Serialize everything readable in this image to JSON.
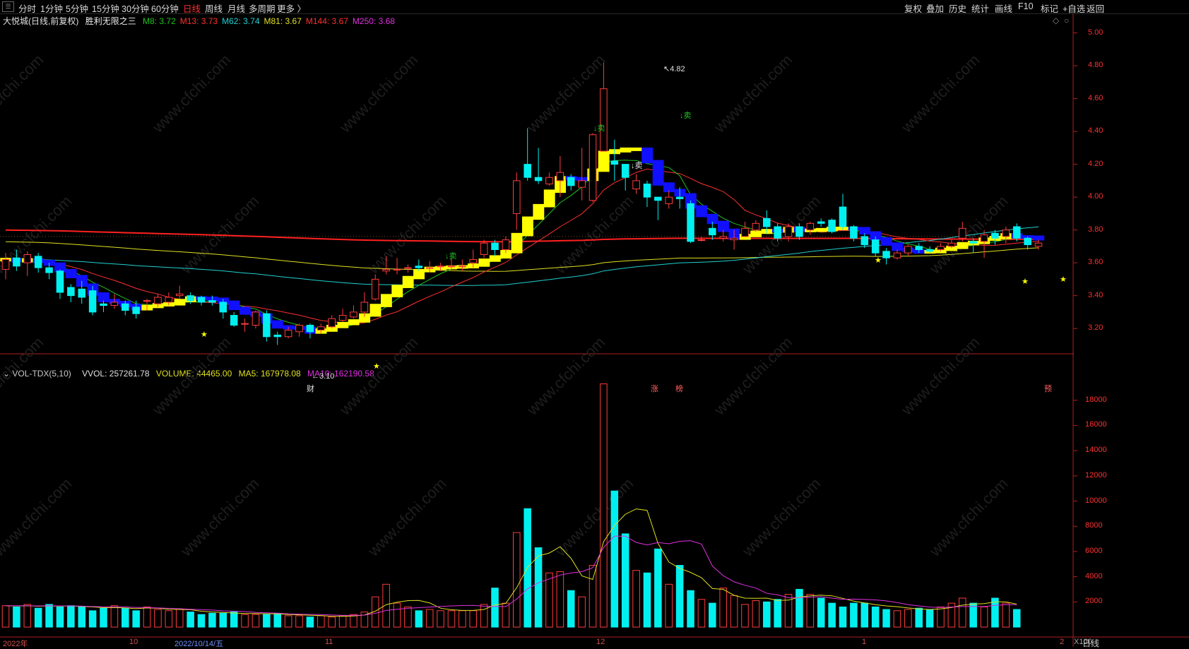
{
  "toolbar": {
    "menu_icon": "menu-icon",
    "periods": [
      "分时",
      "1分钟",
      "5分钟",
      "15分钟",
      "30分钟",
      "60分钟",
      "日线",
      "周线",
      "月线",
      "多周期",
      "更多 〉"
    ],
    "active_period": "日线",
    "right_tools": [
      "复权",
      "叠加",
      "历史",
      "统计",
      "画线",
      "F10",
      "标记",
      "+自选",
      "返回"
    ]
  },
  "price_panel": {
    "stock": "大悦城",
    "mode": "(日线,前复权)",
    "indicator": "胜利无限之三",
    "ma_legend": [
      {
        "label": "M8: 3.72",
        "color": "#20c020"
      },
      {
        "label": "M13: 3.73",
        "color": "#ff3030"
      },
      {
        "label": "M62: 3.74",
        "color": "#20d0d0"
      },
      {
        "label": "M81: 3.67",
        "color": "#e0e020"
      },
      {
        "label": "M144: 3.67",
        "color": "#ff3030"
      },
      {
        "label": "M250: 3.68",
        "color": "#e030e0"
      }
    ],
    "y_ticks": [
      "5.00",
      "4.80",
      "4.60",
      "4.40",
      "4.20",
      "4.00",
      "3.80",
      "3.60",
      "3.40",
      "3.20"
    ],
    "high_label": "4.82",
    "low_label": "3.10",
    "sell_marks": [
      "↓卖",
      "↓卖",
      "↓卖",
      "↓卖"
    ],
    "event_marks": [
      "财",
      "涨",
      "榜",
      "预"
    ],
    "corner_icon": "diamond-icon"
  },
  "volume_panel": {
    "name": "VOL-TDX(5,10)",
    "vvol": "VVOL: 257261.78",
    "volume": "VOLUME: 44465.00",
    "ma5": "MA5: 167978.08",
    "ma10": "MA10: 162190.58",
    "y_ticks": [
      "18000",
      "16000",
      "14000",
      "12000",
      "10000",
      "8000",
      "6000",
      "4000",
      "2000"
    ],
    "unit": "X100"
  },
  "x_axis": {
    "labels": [
      "2022年",
      "10",
      "2022/10/14/五",
      "11",
      "12",
      "1",
      "2"
    ],
    "period_label": "日线"
  },
  "watermark": "www.cfchi.com",
  "colors": {
    "up": "#ff3c3c",
    "down": "#00f0f0",
    "accent": "#ff3030"
  },
  "chart_data": {
    "type": "candlestick",
    "price_ylim": [
      3.05,
      5.05
    ],
    "volume_ylim": [
      0,
      19500
    ],
    "candles": [
      [
        3.56,
        3.62,
        3.5,
        3.66
      ],
      [
        3.63,
        3.58,
        3.55,
        3.68
      ],
      [
        3.6,
        3.65,
        3.52,
        3.67
      ],
      [
        3.64,
        3.57,
        3.54,
        3.66
      ],
      [
        3.57,
        3.54,
        3.5,
        3.6
      ],
      [
        3.55,
        3.42,
        3.38,
        3.56
      ],
      [
        3.45,
        3.4,
        3.36,
        3.47
      ],
      [
        3.44,
        3.39,
        3.35,
        3.49
      ],
      [
        3.43,
        3.3,
        3.28,
        3.46
      ],
      [
        3.35,
        3.34,
        3.3,
        3.37
      ],
      [
        3.34,
        3.36,
        3.32,
        3.41
      ],
      [
        3.35,
        3.31,
        3.28,
        3.37
      ],
      [
        3.33,
        3.29,
        3.26,
        3.37
      ],
      [
        3.37,
        3.37,
        3.31,
        3.38
      ],
      [
        3.35,
        3.39,
        3.33,
        3.41
      ],
      [
        3.36,
        3.39,
        3.34,
        3.42
      ],
      [
        3.4,
        3.41,
        3.38,
        3.46
      ],
      [
        3.4,
        3.37,
        3.35,
        3.42
      ],
      [
        3.39,
        3.36,
        3.34,
        3.4
      ],
      [
        3.37,
        3.36,
        3.34,
        3.4
      ],
      [
        3.36,
        3.3,
        3.26,
        3.38
      ],
      [
        3.28,
        3.22,
        3.21,
        3.3
      ],
      [
        3.23,
        3.23,
        3.18,
        3.26
      ],
      [
        3.22,
        3.3,
        3.2,
        3.31
      ],
      [
        3.29,
        3.15,
        3.12,
        3.31
      ],
      [
        3.16,
        3.15,
        3.1,
        3.18
      ],
      [
        3.15,
        3.19,
        3.14,
        3.21
      ],
      [
        3.18,
        3.22,
        3.15,
        3.23
      ],
      [
        3.22,
        3.18,
        3.14,
        3.23
      ],
      [
        3.19,
        3.21,
        3.17,
        3.23
      ],
      [
        3.21,
        3.26,
        3.2,
        3.28
      ],
      [
        3.25,
        3.28,
        3.24,
        3.32
      ],
      [
        3.27,
        3.3,
        3.26,
        3.34
      ],
      [
        3.3,
        3.36,
        3.27,
        3.42
      ],
      [
        3.38,
        3.5,
        3.37,
        3.53
      ],
      [
        3.55,
        3.56,
        3.53,
        3.64
      ],
      [
        3.56,
        3.56,
        3.53,
        3.63
      ],
      [
        3.57,
        3.57,
        3.54,
        3.59
      ],
      [
        3.58,
        3.57,
        3.55,
        3.62
      ],
      [
        3.57,
        3.57,
        3.54,
        3.61
      ],
      [
        3.58,
        3.58,
        3.55,
        3.6
      ],
      [
        3.58,
        3.58,
        3.56,
        3.63
      ],
      [
        3.58,
        3.58,
        3.55,
        3.62
      ],
      [
        3.6,
        3.62,
        3.57,
        3.68
      ],
      [
        3.65,
        3.72,
        3.63,
        3.74
      ],
      [
        3.72,
        3.68,
        3.64,
        3.74
      ],
      [
        3.68,
        3.74,
        3.66,
        3.76
      ],
      [
        3.9,
        4.1,
        3.8,
        4.15
      ],
      [
        4.2,
        4.12,
        4.1,
        4.42
      ],
      [
        4.12,
        4.1,
        4.08,
        4.3
      ],
      [
        4.08,
        4.12,
        4.07,
        4.15
      ],
      [
        4.1,
        4.15,
        4.0,
        4.25
      ],
      [
        4.12,
        4.07,
        4.04,
        4.14
      ],
      [
        4.06,
        4.1,
        3.98,
        4.3
      ],
      [
        3.98,
        4.38,
        3.97,
        4.39
      ],
      [
        4.28,
        4.66,
        4.38,
        4.82
      ],
      [
        4.22,
        4.2,
        4.1,
        4.35
      ],
      [
        4.2,
        4.12,
        4.04,
        4.18
      ],
      [
        4.05,
        4.1,
        4.02,
        4.14
      ],
      [
        4.08,
        4.0,
        3.94,
        4.1
      ],
      [
        4.0,
        3.98,
        3.86,
        4.0
      ],
      [
        3.96,
        4.0,
        3.93,
        4.04
      ],
      [
        4.0,
        3.99,
        3.93,
        4.06
      ],
      [
        3.96,
        3.73,
        3.72,
        3.98
      ],
      [
        3.74,
        3.74,
        3.73,
        3.76
      ],
      [
        3.81,
        3.77,
        3.74,
        3.85
      ],
      [
        3.75,
        3.76,
        3.73,
        3.8
      ],
      [
        3.74,
        3.75,
        3.68,
        3.8
      ],
      [
        3.76,
        3.81,
        3.76,
        3.85
      ],
      [
        3.8,
        3.84,
        3.79,
        3.86
      ],
      [
        3.87,
        3.82,
        3.78,
        3.92
      ],
      [
        3.82,
        3.75,
        3.73,
        3.84
      ],
      [
        3.76,
        3.82,
        3.73,
        3.84
      ],
      [
        3.82,
        3.76,
        3.74,
        3.84
      ],
      [
        3.8,
        3.84,
        3.77,
        3.85
      ],
      [
        3.85,
        3.84,
        3.82,
        3.87
      ],
      [
        3.86,
        3.79,
        3.78,
        3.87
      ],
      [
        3.94,
        3.82,
        3.8,
        4.02
      ],
      [
        3.82,
        3.75,
        3.73,
        3.83
      ],
      [
        3.76,
        3.71,
        3.69,
        3.78
      ],
      [
        3.74,
        3.66,
        3.64,
        3.76
      ],
      [
        3.67,
        3.63,
        3.59,
        3.69
      ],
      [
        3.63,
        3.66,
        3.62,
        3.68
      ],
      [
        3.66,
        3.7,
        3.64,
        3.71
      ],
      [
        3.7,
        3.68,
        3.66,
        3.72
      ],
      [
        3.68,
        3.67,
        3.66,
        3.7
      ],
      [
        3.68,
        3.7,
        3.67,
        3.72
      ],
      [
        3.7,
        3.72,
        3.69,
        3.74
      ],
      [
        3.75,
        3.81,
        3.73,
        3.85
      ],
      [
        3.73,
        3.72,
        3.66,
        3.75
      ],
      [
        3.73,
        3.77,
        3.63,
        3.8
      ],
      [
        3.78,
        3.75,
        3.71,
        3.8
      ],
      [
        3.76,
        3.8,
        3.72,
        3.82
      ],
      [
        3.82,
        3.75,
        3.73,
        3.84
      ],
      [
        3.75,
        3.71,
        3.68,
        3.76
      ],
      [
        3.7,
        3.72,
        3.68,
        3.74
      ]
    ],
    "volumes": [
      1700,
      1600,
      1800,
      1500,
      1800,
      1600,
      1700,
      1600,
      1300,
      1500,
      1700,
      1500,
      1300,
      1600,
      1400,
      1300,
      1400,
      1200,
      1000,
      1100,
      1100,
      1200,
      1000,
      1000,
      1000,
      1100,
      900,
      900,
      800,
      900,
      800,
      900,
      1000,
      1200,
      2400,
      3400,
      1900,
      1600,
      1300,
      1400,
      1300,
      1300,
      1300,
      1300,
      1800,
      3100,
      1900,
      7500,
      9400,
      6300,
      4300,
      4400,
      2900,
      2400,
      4900,
      19300,
      10800,
      7400,
      4500,
      4300,
      6200,
      3400,
      4900,
      2900,
      2200,
      1900,
      3100,
      2500,
      1800,
      2100,
      2000,
      2200,
      2600,
      3000,
      2600,
      2300,
      1900,
      1600,
      1900,
      1900,
      1600,
      1400,
      1300,
      1400,
      1500,
      1400,
      1600,
      1900,
      2300,
      1900,
      1600,
      2300,
      1900,
      1400
    ]
  }
}
